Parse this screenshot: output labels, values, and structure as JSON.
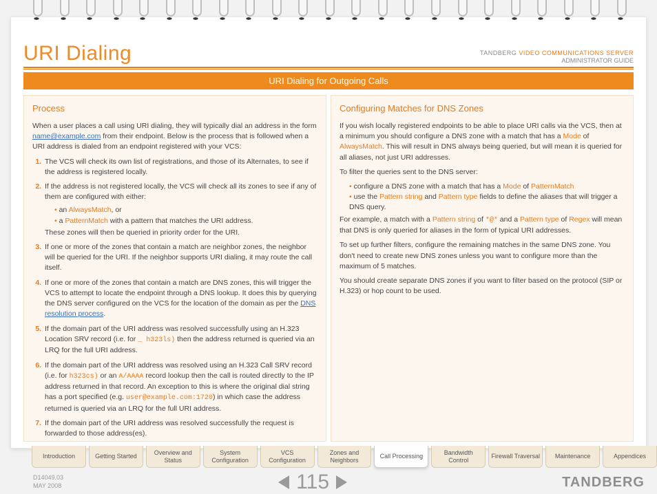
{
  "header": {
    "title": "URI Dialing",
    "brand": "TANDBERG",
    "product": "VIDEO COMMUNICATIONS SERVER",
    "subtitle": "ADMINISTRATOR GUIDE"
  },
  "banner": "URI Dialing for Outgoing Calls",
  "left": {
    "heading": "Process",
    "intro_a": "When a user places a call using URI dialing, they will typically dial an address in the form ",
    "intro_link": "name@example.com",
    "intro_b": " from their endpoint.  Below is the process that is followed when a URI address is dialed from an endpoint registered with your VCS:",
    "li1": "The VCS will check its own list of registrations, and those of its Alternates, to see if the address is registered locally.",
    "li2a": "If the address is not registered locally, the VCS will check all its zones to see if any of them are configured with either:",
    "li2_b1a": "an ",
    "li2_b1b": "AlwaysMatch",
    "li2_b1c": ", or",
    "li2_b2a": "a ",
    "li2_b2b": "PatternMatch",
    "li2_b2c": " with a pattern that matches the URI address.",
    "li2_tail": "These zones will then be queried in priority order for the URI.",
    "li3": "If one or more of the zones that contain a match are neighbor zones, the neighbor will be queried for the URI.  If the neighbor supports URI dialing, it may route the call itself.",
    "li4a": "If one or more of the zones that contain a match are DNS zones, this will trigger the VCS to attempt to locate the endpoint through a DNS lookup.  It does this by querying the DNS server configured on the VCS for the location of the domain as per the ",
    "li4_link": "DNS resolution process",
    "li4b": ".",
    "li5a": "If the domain part of the URI address was resolved successfully using an H.323 Location SRV record (i.e. for ",
    "li5_code": "_ h323ls)",
    "li5b": " then the address returned is queried via an LRQ for the full URI address.",
    "li6a": "If the domain part of the URI address was resolved using an H.323 Call SRV record (i.e. for ",
    "li6_code1": "h323cs)",
    "li6b": " or an ",
    "li6_code2": "A/AAAA",
    "li6c": " record lookup then the call is routed directly to the IP address returned in that record.  An exception to this is where the original dial string has a port specified (e.g. ",
    "li6_code3": "user@example.com:1720",
    "li6d": ") in which case the address returned is queried via an LRQ for the full URI address.",
    "li7": "If the domain part of the URI address was resolved successfully the request is forwarded to those address(es)."
  },
  "right": {
    "heading": "Configuring Matches for DNS Zones",
    "p1a": "If you wish locally registered endpoints to be able to place URI calls via the VCS, then at a minimum you should configure a DNS zone with a match that has a ",
    "p1_mode": "Mode",
    "p1b": " of ",
    "p1_am": "AlwaysMatch",
    "p1c": ".  This will result in DNS always being queried, but will mean it is queried for all aliases, not just URI addresses.",
    "p2": "To filter the queries sent to the DNS server:",
    "b1a": "configure a DNS zone with a match that has a ",
    "b1_mode": "Mode",
    "b1b": " of ",
    "b1_pm": "PatternMatch",
    "b2a": "use the ",
    "b2_ps": "Pattern string",
    "b2b": " and ",
    "b2_pt": "Pattern type",
    "b2c": " fields to define the aliases that will trigger a DNS query.",
    "p3a": "For example, a match with a ",
    "p3_ps": "Pattern string",
    "p3b": " of ",
    "p3_code": "*@*",
    "p3c": " and a ",
    "p3_pt": "Pattern type",
    "p3d": " of ",
    "p3_regex": "Regex",
    "p3e": " will mean that DNS is only queried for aliases in the form of typical URI addresses.",
    "p4": "To set up further filters, configure the remaining matches in the same DNS zone.  You don't need to create new DNS zones unless you want to configure more than the maximum of 5 matches.",
    "p5": "You should create separate DNS zones if you want to filter based on the protocol (SIP or H.323) or hop count to be used."
  },
  "tabs": [
    "Introduction",
    "Getting Started",
    "Overview and Status",
    "System Configuration",
    "VCS Configuration",
    "Zones and Neighbors",
    "Call Processing",
    "Bandwidth Control",
    "Firewall Traversal",
    "Maintenance",
    "Appendices"
  ],
  "active_tab_index": 6,
  "footer": {
    "docid": "D14049.03",
    "date": "MAY 2008",
    "page": "115",
    "brand": "TANDBERG"
  }
}
